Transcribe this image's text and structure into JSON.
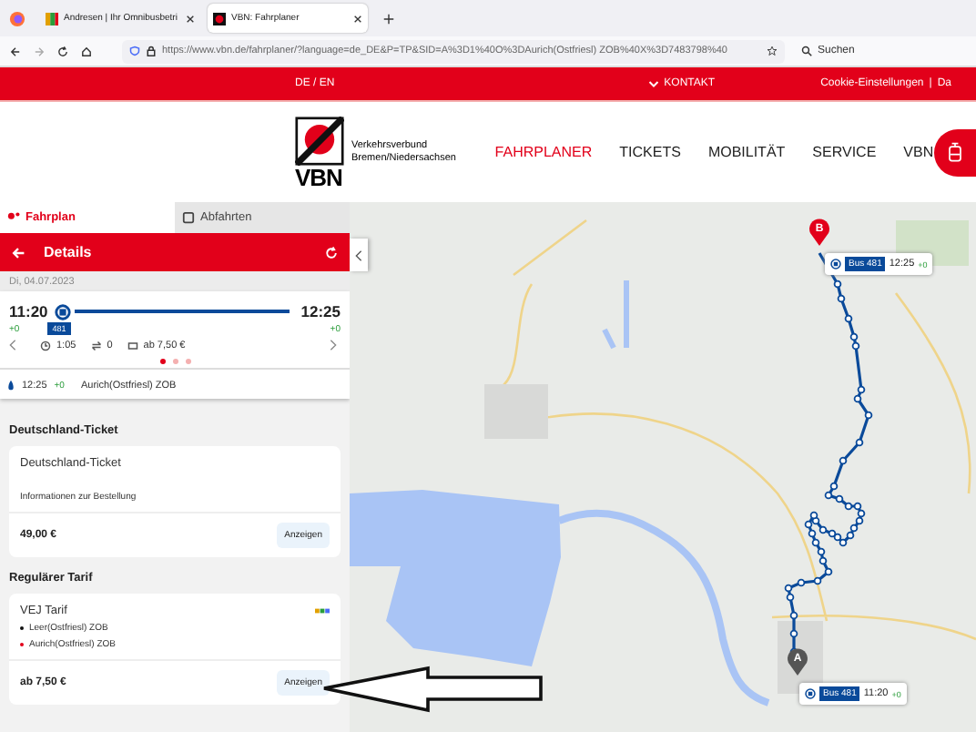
{
  "browser": {
    "tabs": [
      {
        "title": "Andresen | Ihr Omnibusbetri",
        "selected": false
      },
      {
        "title": "VBN: Fahrplaner",
        "selected": true
      }
    ],
    "url": "https://www.vbn.de/fahrplaner/?language=de_DE&P=TP&SID=A%3D1%40O%3DAurich(Ostfriesl) ZOB%40X%3D7483798%40",
    "search_placeholder": "Suchen"
  },
  "top_bar": {
    "language": "DE / EN",
    "contact": "KONTAKT",
    "cookie": "Cookie-Einstellungen",
    "separator": "|",
    "cut_link": "Da"
  },
  "header": {
    "logo": "VBN",
    "logo_subtitle": [
      "Verkehrsverbund",
      "Bremen/Niedersachsen"
    ],
    "nav": [
      {
        "label": "FAHRPLANER",
        "selected": true
      },
      {
        "label": "TICKETS",
        "selected": false
      },
      {
        "label": "MOBILITÄT",
        "selected": false
      },
      {
        "label": "SERVICE",
        "selected": false
      },
      {
        "label": "VBN",
        "selected": false
      }
    ]
  },
  "panel": {
    "tabs": [
      {
        "label": "Fahrplan",
        "selected": true
      },
      {
        "label": "Abfahrten",
        "selected": false
      }
    ],
    "title": "Details",
    "date": "Di, 04.07.2023",
    "trip": {
      "departure": "11:20",
      "departure_delay": "+0",
      "arrival": "12:25",
      "arrival_delay": "+0",
      "line": "481",
      "duration": "1:05",
      "changes": "0",
      "price": "ab 7,50 €"
    },
    "pager": [
      {
        "selected": true
      },
      {
        "selected": false
      },
      {
        "selected": false
      }
    ],
    "stop": {
      "time": "12:25",
      "delay": "+0",
      "name": "Aurich(Ostfriesl) ZOB"
    },
    "sections": [
      {
        "heading": "Deutschland-Ticket",
        "title": "Deutschland-Ticket",
        "info": "Informationen zur Bestellung",
        "price": "49,00 €",
        "button": "Anzeigen"
      },
      {
        "heading": "Regulärer Tarif",
        "title": "VEJ Tarif",
        "stops": [
          "Leer(Ostfriesl) ZOB",
          "Aurich(Ostfriesl) ZOB"
        ],
        "price": "ab 7,50 €",
        "button": "Anzeigen"
      }
    ]
  },
  "map": {
    "markers": [
      {
        "letter": "B",
        "color": "#e2001a"
      },
      {
        "letter": "A",
        "color": "#555555"
      }
    ],
    "labels": [
      {
        "line": "Bus 481",
        "time": "12:25",
        "delay": "+0"
      },
      {
        "line": "Bus 481",
        "time": "11:20",
        "delay": "+0"
      }
    ]
  }
}
